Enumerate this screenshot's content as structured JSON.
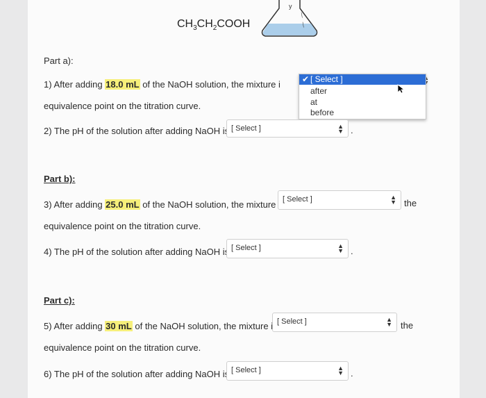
{
  "header": {
    "formula_parts": [
      "CH",
      "3",
      "CH",
      "2",
      "COOH"
    ],
    "flask_marks": [
      "у",
      "—",
      "—"
    ]
  },
  "part_a": {
    "title": "Part a):",
    "q1": {
      "prefix": "1) After adding ",
      "amount": "18.0 mL",
      "mid": " of the NaOH solution, the mixture i",
      "suffix": "the",
      "line2": "equivalence point on the titration curve.",
      "dropdown_options": [
        "[ Select ]",
        "after",
        "at",
        "before"
      ],
      "selected_index": 0,
      "check": "✔"
    },
    "q2": {
      "text": "2) The pH of the solution after adding NaOH is",
      "select": "[ Select ]"
    }
  },
  "part_b": {
    "title": "Part b):",
    "q3": {
      "prefix": "3) After adding ",
      "amount": "25.0 mL",
      "mid": " of the NaOH solution, the mixture is",
      "select": "[ Select ]",
      "suffix": "the",
      "line2": "equivalence point on the titration curve."
    },
    "q4": {
      "text": "4) The pH of the solution after adding NaOH is",
      "select": "[ Select ]"
    }
  },
  "part_c": {
    "title": "Part c):",
    "q5": {
      "prefix": "5) After adding ",
      "amount": "30 mL",
      "mid": " of the NaOH solution, the mixture is",
      "select": "[ Select ]",
      "suffix": "the",
      "line2": "equivalence point on the titration curve."
    },
    "q6": {
      "text": "6) The pH of the solution after adding NaOH is",
      "select": "[ Select ]"
    }
  },
  "period": ".",
  "colors": {
    "highlight": "#f6ef7a",
    "selection": "#2c6dd5",
    "flask_liquid": "#9cc6e6"
  }
}
